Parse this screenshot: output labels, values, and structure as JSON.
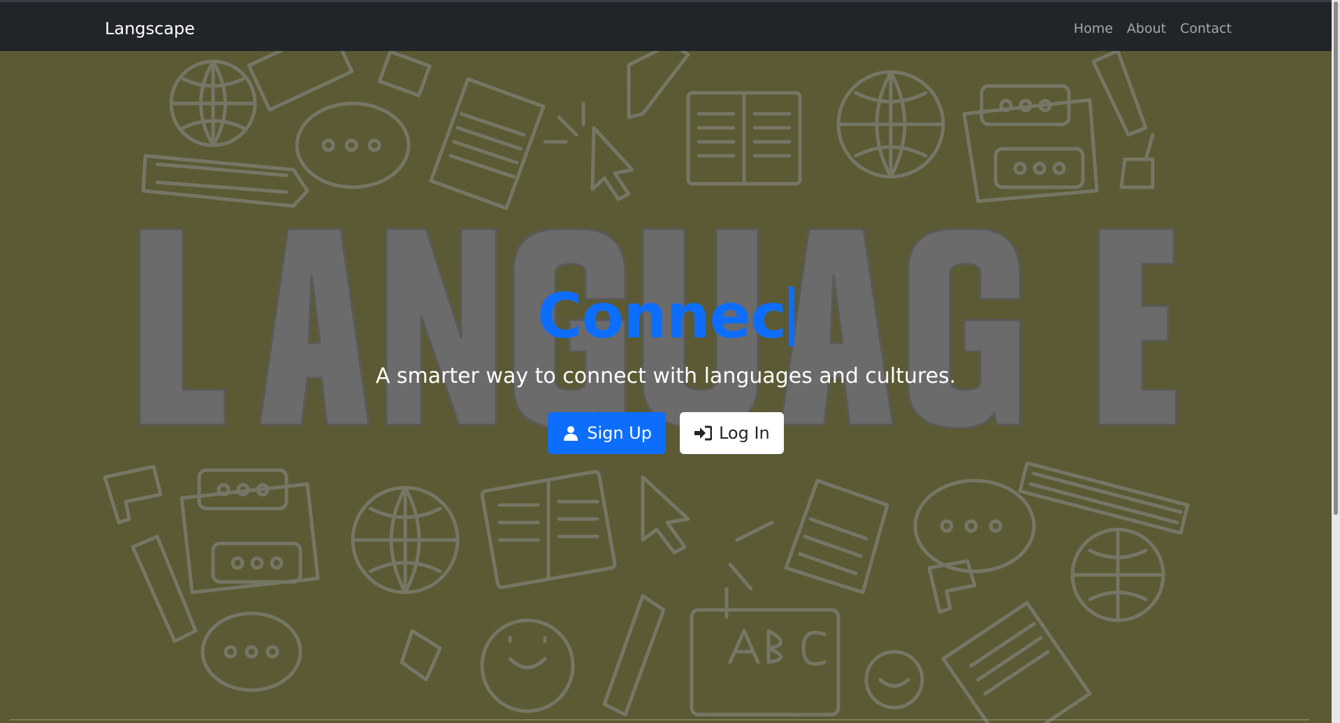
{
  "navbar": {
    "brand": "Langscape",
    "links": [
      "Home",
      "About",
      "Contact"
    ]
  },
  "hero": {
    "background_word": "LANGUAGE",
    "background_badge": "ABC",
    "typed_text": "Connec",
    "tagline": "A smarter way to connect with languages and cultures.",
    "buttons": {
      "signup": {
        "label": "Sign Up",
        "icon": "user-icon"
      },
      "login": {
        "label": "Log In",
        "icon": "sign-in-icon"
      }
    }
  },
  "colors": {
    "navbar": "#212529",
    "hero_bg": "#5b5a34",
    "accent": "#0d6efd"
  }
}
